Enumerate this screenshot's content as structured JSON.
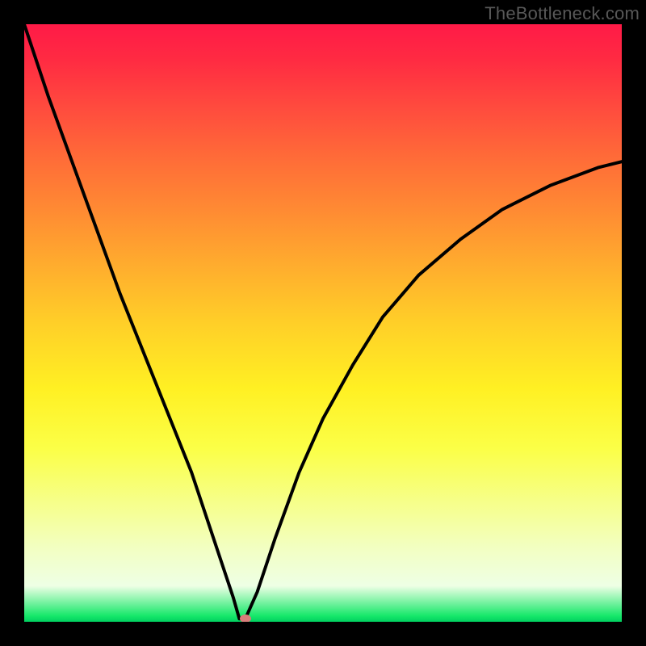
{
  "watermark": "TheBottleneck.com",
  "chart_data": {
    "type": "line",
    "title": "",
    "xlabel": "",
    "ylabel": "",
    "xlim": [
      0,
      100
    ],
    "ylim": [
      0,
      100
    ],
    "grid": false,
    "legend": false,
    "notch_x": 36,
    "marker": {
      "x": 37,
      "y": 0.5
    },
    "series": [
      {
        "name": "curve",
        "x": [
          0,
          4,
          8,
          12,
          16,
          20,
          24,
          28,
          31,
          33,
          35,
          36,
          37,
          39,
          42,
          46,
          50,
          55,
          60,
          66,
          73,
          80,
          88,
          96,
          100
        ],
        "y": [
          100,
          88,
          77,
          66,
          55,
          45,
          35,
          25,
          16,
          10,
          4,
          0.5,
          0.5,
          5,
          14,
          25,
          34,
          43,
          51,
          58,
          64,
          69,
          73,
          76,
          77
        ]
      }
    ],
    "background_gradient": {
      "top": "#ff1a47",
      "mid": "#ffd228",
      "bottom": "#00d060"
    }
  }
}
